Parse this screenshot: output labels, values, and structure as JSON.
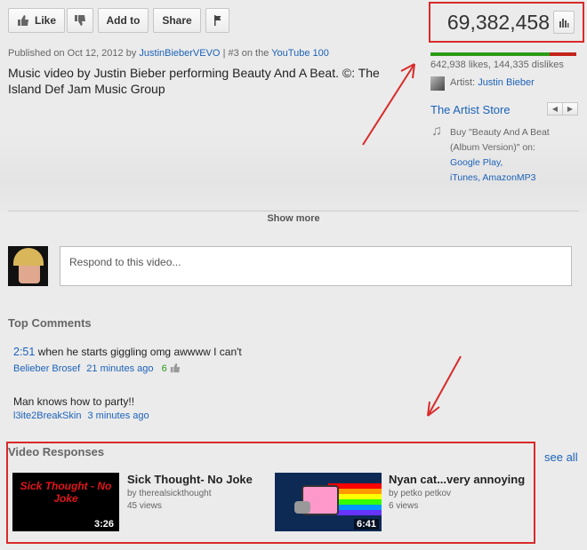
{
  "actions": {
    "like_label": "Like",
    "add_to_label": "Add to",
    "share_label": "Share"
  },
  "published": {
    "prefix": "Published on Oct 12, 2012 by",
    "channel": "JustinBieberVEVO",
    "rank_text": "| #3 on the",
    "list_name": "YouTube 100"
  },
  "description": "Music video by Justin Bieber performing Beauty And A Beat. ©: The Island Def Jam Music Group",
  "stats": {
    "view_count": "69,382,458",
    "likes_text": "642,938 likes, 144,335 dislikes",
    "like_ratio": 0.8166
  },
  "artist": {
    "label": "Artist:",
    "name": "Justin Bieber"
  },
  "artist_store": {
    "title": "The Artist Store",
    "buy_line1": "Buy \"Beauty And A Beat",
    "buy_line2": "(Album Version)\" on:",
    "store1": "Google Play,",
    "store2": "iTunes,",
    "store3": "AmazonMP3"
  },
  "show_more_label": "Show more",
  "respond_placeholder": "Respond to this video...",
  "comments": {
    "heading": "Top Comments",
    "items": [
      {
        "timestamp_link": "2:51",
        "text": "when he starts giggling omg awwww I can't",
        "author": "Belieber Brosef",
        "time": "21 minutes ago",
        "votes": "6"
      },
      {
        "text": "Man knows how to party!!",
        "author": "l3ite2BreakSkin",
        "time": "3 minutes ago"
      }
    ]
  },
  "video_responses": {
    "heading": "Video Responses",
    "see_all": "see all",
    "items": [
      {
        "thumb_text": "Sick Thought - No Joke",
        "duration": "3:26",
        "title": "Sick Thought- No Joke",
        "by": "by therealsickthought",
        "views": "45 views"
      },
      {
        "duration": "6:41",
        "title": "Nyan cat...very annoying",
        "by": "by petko petkov",
        "views": "6 views"
      }
    ]
  },
  "colors": {
    "link": "#1c62b9",
    "annotation_red": "#d92a2a",
    "like_green": "#2d9b17",
    "dislike_red": "#c3231a"
  }
}
